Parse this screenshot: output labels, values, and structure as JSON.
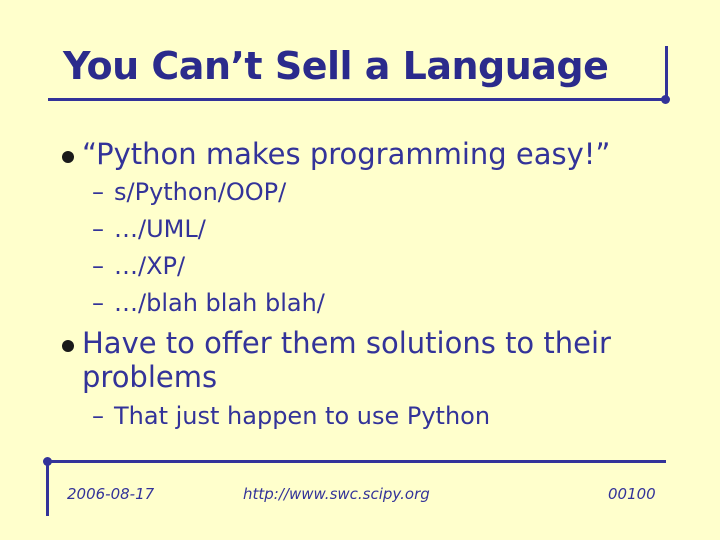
{
  "slide": {
    "title": "You Can’t Sell a Language",
    "bullets": [
      {
        "text": "“Python makes programming easy!”",
        "subs": [
          "s/Python/OOP/",
          "…/UML/",
          "…/XP/",
          "…/blah blah blah/"
        ]
      },
      {
        "line1": "Have to offer them solutions to their",
        "line2": "problems",
        "subs": [
          "That just happen to use Python"
        ]
      }
    ],
    "dash": "–"
  },
  "footer": {
    "date": "2006-08-17",
    "url": "http://www.swc.scipy.org",
    "page": "00100"
  },
  "colors": {
    "background": "#FFFFCC",
    "text": "#333399",
    "rules": "#333399"
  }
}
